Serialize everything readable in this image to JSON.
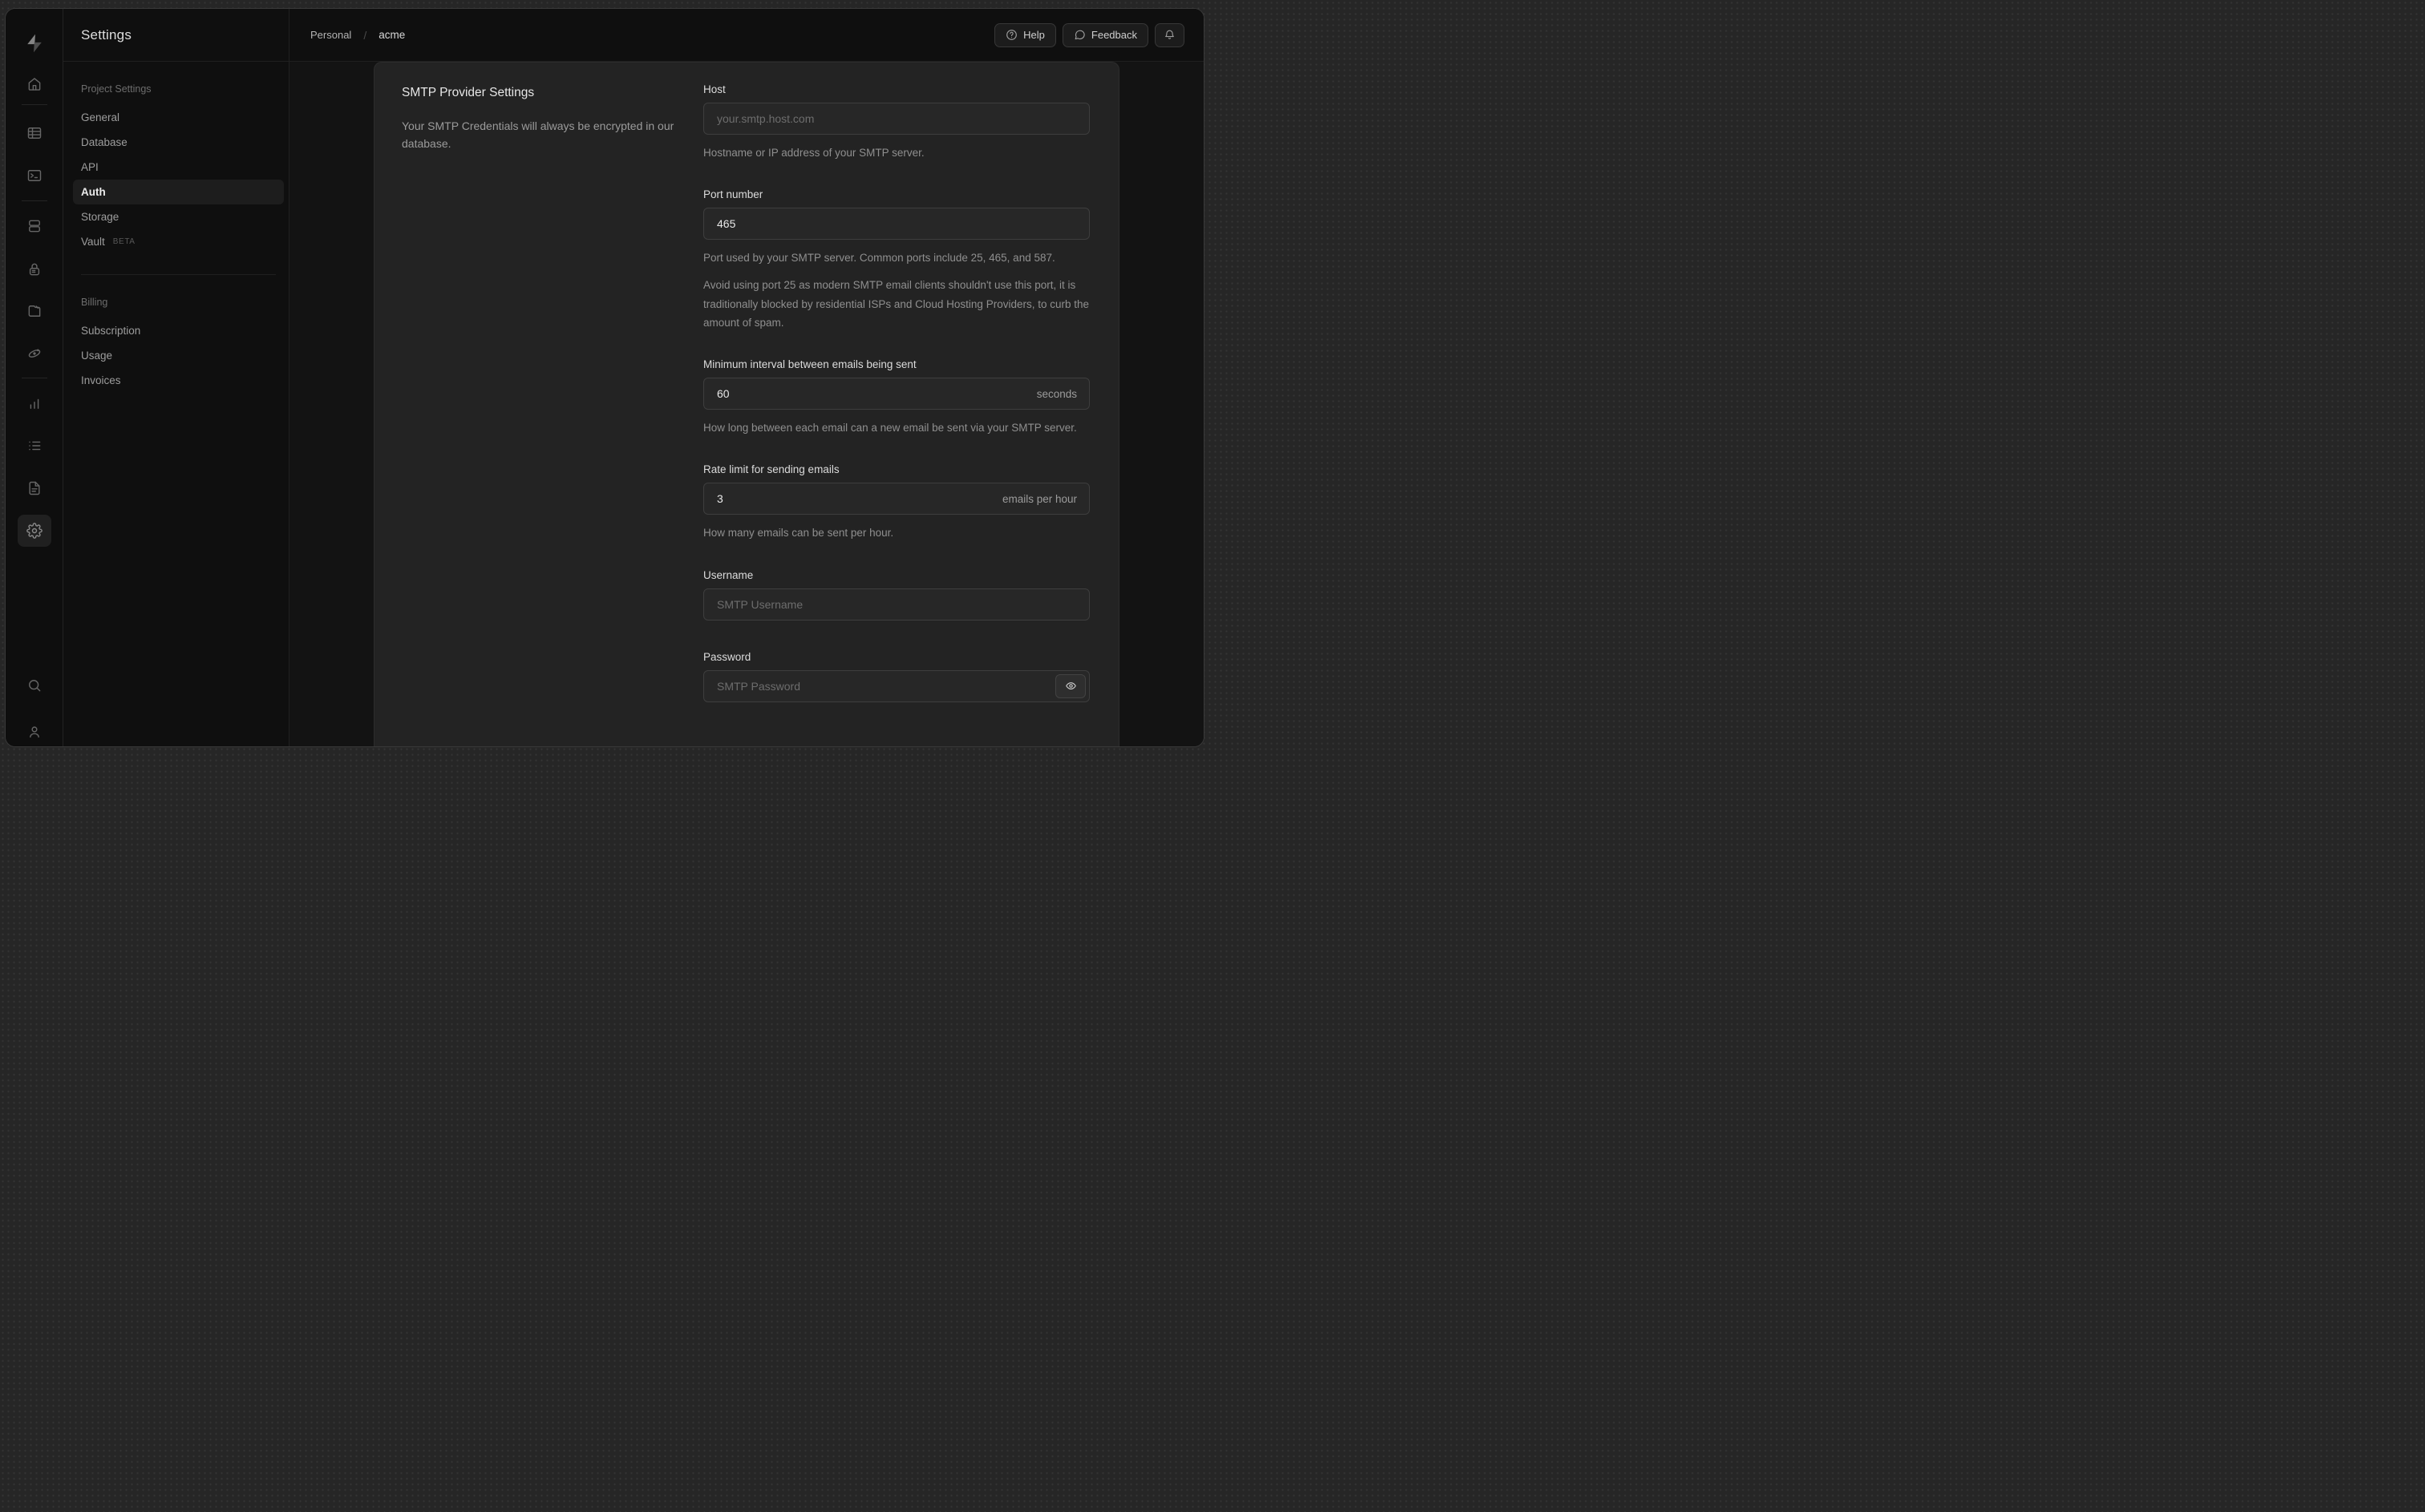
{
  "colors": {
    "backdrop": "#262626",
    "chrome_bg": "#0f0f0f",
    "page_bg": "#131313",
    "card_bg": "#232323",
    "input_bg": "#272727",
    "active_item_bg": "#1d1d1d"
  },
  "rail": {
    "icons": [
      "supabase-logo",
      "home-icon",
      "table-editor-icon",
      "sql-editor-icon",
      "database-icon",
      "auth-icon",
      "storage-icon",
      "edge-functions-icon",
      "reports-icon",
      "logs-icon",
      "docs-icon",
      "settings-icon",
      "search-icon",
      "user-icon"
    ]
  },
  "sidebar": {
    "title": "Settings",
    "sections": [
      {
        "header": "Project Settings",
        "items": [
          {
            "label": "General"
          },
          {
            "label": "Database"
          },
          {
            "label": "API"
          },
          {
            "label": "Auth"
          },
          {
            "label": "Storage"
          },
          {
            "label": "Vault",
            "badge": "BETA"
          }
        ]
      },
      {
        "header": "Billing",
        "items": [
          {
            "label": "Subscription"
          },
          {
            "label": "Usage"
          },
          {
            "label": "Invoices"
          }
        ]
      }
    ]
  },
  "topbar": {
    "breadcrumb": {
      "org": "Personal",
      "separator": "/",
      "project": "acme"
    },
    "help_label": "Help",
    "feedback_label": "Feedback",
    "icons": [
      "help-icon",
      "feedback-icon",
      "notifications-icon"
    ]
  },
  "panel": {
    "title": "SMTP Provider Settings",
    "description": "Your SMTP Credentials will always be encrypted in our database.",
    "fields": {
      "host": {
        "label": "Host",
        "placeholder": "your.smtp.host.com",
        "helper": "Hostname or IP address of your SMTP server."
      },
      "port": {
        "label": "Port number",
        "value": "465",
        "helper": "Port used by your SMTP server. Common ports include 25, 465, and 587.",
        "note": "Avoid using port 25 as modern SMTP email clients shouldn't use this port, it is traditionally blocked by residential ISPs and Cloud Hosting Providers, to curb the amount of spam."
      },
      "interval": {
        "label": "Minimum interval between emails being sent",
        "value": "60",
        "suffix": "seconds",
        "helper": "How long between each email can a new email be sent via your SMTP server."
      },
      "rate": {
        "label": "Rate limit for sending emails",
        "value": "3",
        "suffix": "emails per hour",
        "helper": "How many emails can be sent per hour."
      },
      "username": {
        "label": "Username",
        "placeholder": "SMTP Username"
      },
      "password": {
        "label": "Password",
        "placeholder": "SMTP Password"
      }
    }
  }
}
